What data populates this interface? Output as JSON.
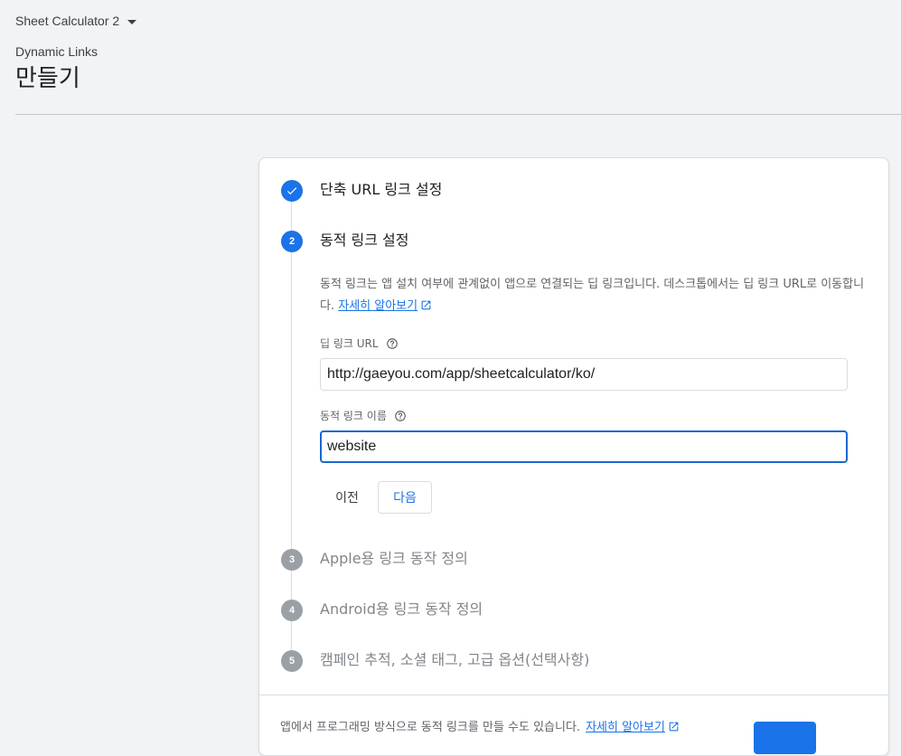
{
  "header": {
    "project_name": "Sheet Calculator 2",
    "breadcrumb": "Dynamic Links",
    "title": "만들기"
  },
  "steps": [
    {
      "number": "",
      "title": "단축 URL 링크 설정",
      "state": "done"
    },
    {
      "number": "2",
      "title": "동적 링크 설정",
      "state": "active"
    },
    {
      "number": "3",
      "title": "Apple용 링크 동작 정의",
      "state": "pending"
    },
    {
      "number": "4",
      "title": "Android용 링크 동작 정의",
      "state": "pending"
    },
    {
      "number": "5",
      "title": "캠페인 추적, 소셜 태그, 고급 옵션(선택사항)",
      "state": "pending"
    }
  ],
  "step2": {
    "description": "동적 링크는 앱 설치 여부에 관계없이 앱으로 연결되는 딥 링크입니다. 데스크톱에서는 딥 링크 URL로 이동합니다.",
    "learn_more": "자세히 알아보기",
    "deep_link_label": "딥 링크 URL",
    "deep_link_value": "http://gaeyou.com/app/sheetcalculator/ko/",
    "link_name_label": "동적 링크 이름",
    "link_name_value": "website",
    "prev_label": "이전",
    "next_label": "다음"
  },
  "footer": {
    "text": "앱에서 프로그래밍 방식으로 동적 링크를 만들 수도 있습니다.",
    "learn_more": "자세히 알아보기"
  },
  "colors": {
    "accent": "#1a73e8",
    "pending": "#9aa0a6",
    "background": "#f1f3f4"
  }
}
